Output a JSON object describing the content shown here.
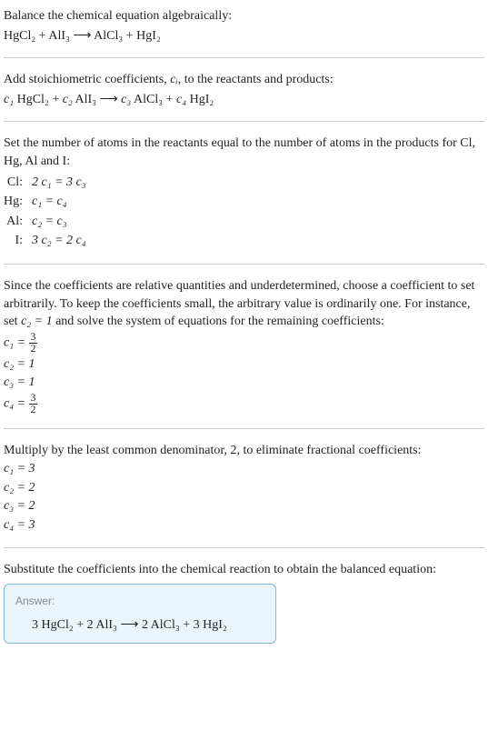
{
  "intro": {
    "line1": "Balance the chemical equation algebraically:",
    "eq": "HgCl₂ + AlI₃  ⟶  AlCl₃ + HgI₂"
  },
  "stoich": {
    "line1_a": "Add stoichiometric coefficients, ",
    "line1_var": "cᵢ",
    "line1_b": ", to the reactants and products:",
    "eq_c1": "c₁",
    "eq_r1": " HgCl₂ + ",
    "eq_c2": "c₂",
    "eq_r2": " AlI₃  ⟶  ",
    "eq_c3": "c₃",
    "eq_r3": " AlCl₃ + ",
    "eq_c4": "c₄",
    "eq_r4": " HgI₂"
  },
  "atoms": {
    "intro": "Set the number of atoms in the reactants equal to the number of atoms in the products for Cl, Hg, Al and I:",
    "rows": [
      {
        "el": "Cl:",
        "eq": "2 c₁ = 3 c₃"
      },
      {
        "el": "Hg:",
        "eq": "c₁ = c₄"
      },
      {
        "el": "Al:",
        "eq": "c₂ = c₃"
      },
      {
        "el": "I:",
        "eq": "3 c₂ = 2 c₄"
      }
    ]
  },
  "solve": {
    "intro_a": "Since the coefficients are relative quantities and underdetermined, choose a coefficient to set arbitrarily. To keep the coefficients small, the arbitrary value is ordinarily one. For instance, set ",
    "intro_var": "c₂ = 1",
    "intro_b": " and solve the system of equations for the remaining coefficients:",
    "c1_lhs": "c₁ = ",
    "c1_num": "3",
    "c1_den": "2",
    "c2": "c₂ = 1",
    "c3": "c₃ = 1",
    "c4_lhs": "c₄ = ",
    "c4_num": "3",
    "c4_den": "2"
  },
  "lcd": {
    "intro": "Multiply by the least common denominator, 2, to eliminate fractional coefficients:",
    "c1": "c₁ = 3",
    "c2": "c₂ = 2",
    "c3": "c₃ = 2",
    "c4": "c₄ = 3"
  },
  "final": {
    "intro": "Substitute the coefficients into the chemical reaction to obtain the balanced equation:"
  },
  "answer": {
    "label": "Answer:",
    "eq": "3 HgCl₂ + 2 AlI₃  ⟶  2 AlCl₃ + 3 HgI₂"
  }
}
